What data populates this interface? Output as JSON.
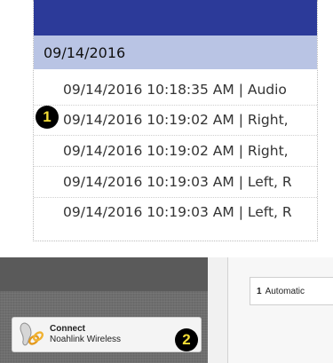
{
  "log": {
    "date_group": "09/14/2016",
    "entries": [
      "09/14/2016 10:18:35 AM | Audio",
      "09/14/2016 10:19:02 AM | Right,",
      "09/14/2016 10:19:02 AM | Right,",
      "09/14/2016 10:19:03 AM | Left, R",
      "09/14/2016 10:19:03 AM | Left, R"
    ]
  },
  "callouts": {
    "first": "1",
    "second": "2"
  },
  "app": {
    "program": {
      "number": "1",
      "name": "Automatic"
    },
    "connect": {
      "title": "Connect",
      "subtitle": "Noahlink Wireless",
      "icon": "hearing-aid-link-icon"
    }
  },
  "colors": {
    "header_bar": "#2c3a99",
    "date_group_bg": "#b9c4e4",
    "callout_bg": "#000000",
    "callout_text": "#f4de36",
    "sidebar_gray": "#6e6e6e"
  }
}
